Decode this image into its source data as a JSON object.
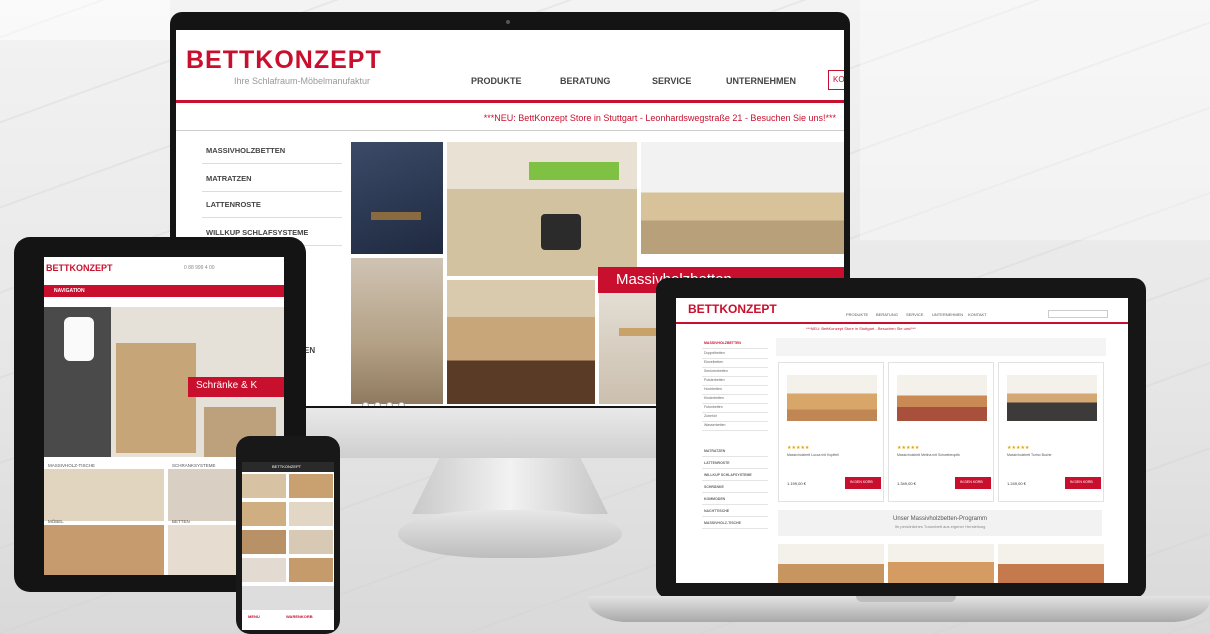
{
  "colors": {
    "brand_red": "#c8102e",
    "bezel": "#141414"
  },
  "monitor": {
    "logo": "BETTKONZEPT",
    "tagline": "Ihre Schlafraum-Möbelmanufaktur",
    "nav": [
      "PRODUKTE",
      "BERATUNG",
      "SERVICE",
      "UNTERNEHMEN",
      "KO"
    ],
    "ticker": "***NEU: BettKonzept Store in Stuttgart - Leonhardsweg​straße 21 - Besuchen Sie uns!***",
    "sidebar": [
      "MASSIVHOLZBETTEN",
      "MATRATZEN",
      "LATTENROSTE",
      "WILLKUP SCHLAFSYSTEME"
    ],
    "partial_label": "EN",
    "hero_badge": "Massivholzbetten"
  },
  "tablet": {
    "logo": "BETTKONZEPT",
    "phone": "0 88 999 4 00",
    "menu": "NAVIGATION",
    "badge": "Schränke & K",
    "captions": [
      "MASSIVHOLZ-TISCHE",
      "SCHRANKSYSTEME",
      "MÖBEL",
      "BETTEN"
    ]
  },
  "phone": {
    "header": "BETTKONZEPT",
    "footer": [
      "MENU",
      "WARENKORB"
    ]
  },
  "laptop": {
    "logo": "BETTKONZEPT",
    "nav": [
      "PRODUKTE",
      "BERATUNG",
      "SERVICE",
      "UNTERNEHMEN",
      "KONTAKT"
    ],
    "ticker": "***NEU: BettKonzept Store in Stuttgart - Besuchen Sie uns!***",
    "sidebar": [
      "MASSIVHOLZBETTEN",
      "Doppelbetten",
      "Einzelbetten",
      "Seniorenbetten",
      "Polsterbetten",
      "Hochbetten",
      "Kinderbetten",
      "Futonbetten",
      "Zubehör",
      "Wasserbetten",
      "MATRATZEN",
      "LATTENROSTE",
      "WILLKUP SCHLAFSYSTEME",
      "SCHRÄNKE",
      "KOMMODEN",
      "NACHTTISCHE",
      "MASSIVHOLZ-TISCHE"
    ],
    "products": [
      {
        "stars": "★★★★★",
        "name": "Massivholzbett Lucca mit Kopfteil",
        "price": "1.199,00 €",
        "button": "IN DEN KORB"
      },
      {
        "stars": "★★★★★",
        "name": "Massivholzbett Melina mit Schwebeoptik",
        "price": "1.349,00 €",
        "button": "IN DEN KORB"
      },
      {
        "stars": "★★★★★",
        "name": "Massivholzbett Torino Buche",
        "price": "1.249,00 €",
        "button": "IN DEN KORB"
      }
    ],
    "banner_title": "Unser Massivholzbetten-Programm",
    "banner_sub": "Ihr persönliches Traumbett aus eigener Herstellung"
  }
}
